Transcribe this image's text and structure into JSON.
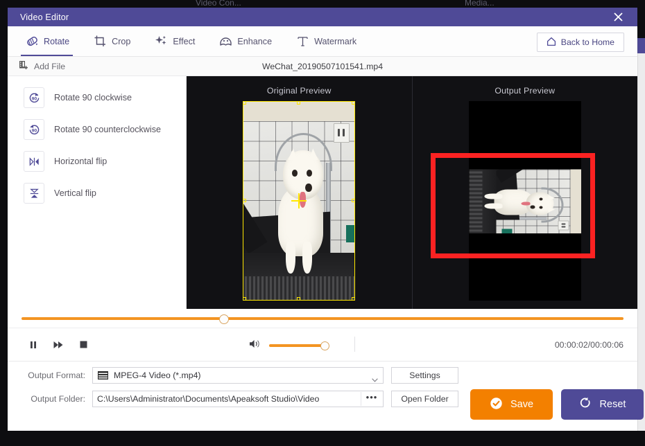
{
  "background": {
    "ghost_title_left": "Video Con...",
    "ghost_title_right": "Media..."
  },
  "window": {
    "title": "Video Editor",
    "close_label": "×"
  },
  "tabs": [
    {
      "label": "Rotate",
      "icon": "rotate-icon",
      "active": true
    },
    {
      "label": "Crop",
      "icon": "crop-icon",
      "active": false
    },
    {
      "label": "Effect",
      "icon": "sparkle-icon",
      "active": false
    },
    {
      "label": "Enhance",
      "icon": "enhance-icon",
      "active": false
    },
    {
      "label": "Watermark",
      "icon": "text-t-icon",
      "active": false
    }
  ],
  "header": {
    "back_home_label": "Back to Home",
    "back_home_icon": "home-icon"
  },
  "filebar": {
    "add_file_label": "Add File",
    "add_file_icon": "add-file-icon",
    "filename": "WeChat_20190507101541.mp4"
  },
  "sidebar": {
    "items": [
      {
        "label": "Rotate 90 clockwise",
        "icon": "rotate-cw-90-icon"
      },
      {
        "label": "Rotate 90 counterclockwise",
        "icon": "rotate-ccw-90-icon"
      },
      {
        "label": "Horizontal flip",
        "icon": "horizontal-flip-icon"
      },
      {
        "label": "Vertical flip",
        "icon": "vertical-flip-icon"
      }
    ]
  },
  "preview": {
    "original_title": "Original Preview",
    "output_title": "Output Preview",
    "annotation": "red-highlight-box"
  },
  "transport": {
    "pause_icon": "pause-icon",
    "forward_icon": "fast-forward-icon",
    "stop_icon": "stop-icon",
    "volume_icon": "volume-icon",
    "timecode": "00:00:02/00:00:06",
    "progress_percent": 33.5,
    "volume_percent": 100
  },
  "output": {
    "format_label": "Output Format:",
    "format_value": "MPEG-4 Video (*.mp4)",
    "format_icon": "mpeg-film-icon",
    "settings_label": "Settings",
    "folder_label": "Output Folder:",
    "folder_value": "C:\\Users\\Administrator\\Documents\\Apeaksoft Studio\\Video",
    "browse_label": "•••",
    "open_folder_label": "Open Folder"
  },
  "actions": {
    "save_label": "Save",
    "save_icon": "check-circle-icon",
    "reset_label": "Reset",
    "reset_icon": "reset-arrow-icon"
  },
  "colors": {
    "purple": "#4F4A97",
    "orange": "#F38000",
    "track_orange": "#F39422",
    "annotation_red": "#FB2222",
    "stage_black": "#111114",
    "crop_yellow": "#FFE800"
  }
}
